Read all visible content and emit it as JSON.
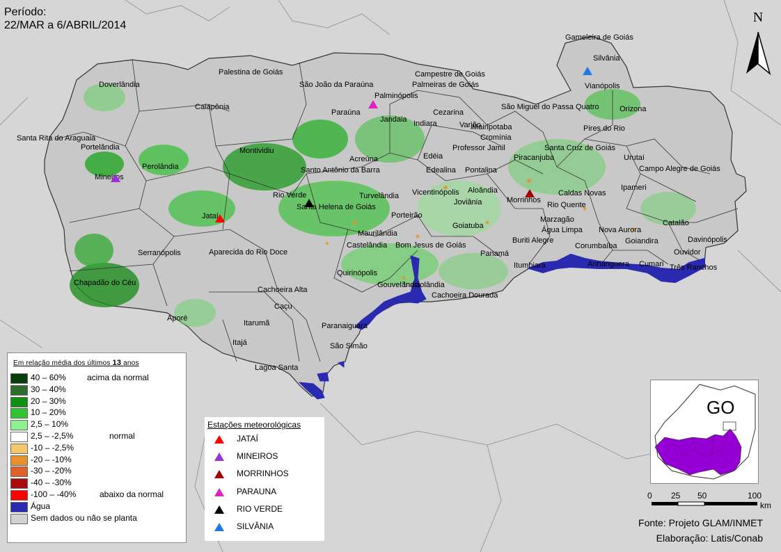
{
  "period": {
    "label": "Período:",
    "range": "22/MAR a 6/ABRIL/2014"
  },
  "north": {
    "letter": "N",
    "icon": "north-arrow-icon"
  },
  "municipality_labels": [
    "Gameleira de Goiás",
    "Silvânia",
    "Vianópolis",
    "Orizona",
    "São Miguel do Passa Quatro",
    "Pires do Rio",
    "Santa Cruz de Goiás",
    "Urutaí",
    "Campo Alegre de Goiás",
    "Ipameri",
    "Caldas Novas",
    "Rio Quente",
    "Marzagão",
    "Nova Aurora",
    "Goiandira",
    "Catalão",
    "Davinópolis",
    "Ouvidor",
    "Três Ranchos",
    "Cumari",
    "Anhanguera",
    "Corumbaíba",
    "Água Limpa",
    "Buriti Alegre",
    "Itumbiara",
    "Morrinhos",
    "Piracanjuba",
    "Cromínia",
    "Mairipotaba",
    "Professor Jamil",
    "Pontalina",
    "Aloândia",
    "Joviânia",
    "Goiatuba",
    "Panamá",
    "Bom Jesus de Goiás",
    "Castelândia",
    "Maurilândia",
    "Porteirão",
    "Turvelândia",
    "Vicentinópolis",
    "Edealina",
    "Edéia",
    "Indiara",
    "Varjão",
    "Cezarina",
    "Jandaia",
    "Palminópolis",
    "Paraúna",
    "Acreúna",
    "Santo Antônio da Barra",
    "Rio Verde",
    "Santa Helena de Goiás",
    "Montividiu",
    "Campestre de Goiás",
    "Palmeiras de Goiás",
    "São João da Paraúna",
    "Palestina de Goiás",
    "Caiapônia",
    "Doverlândia",
    "Santa Rita do Araguaia",
    "Portelândia",
    "Perolândia",
    "Mineiros",
    "Jataí",
    "Serranópolis",
    "Chapadão do Céu",
    "Aporé",
    "Aparecida do Rio Doce",
    "Cachoeira Alta",
    "Caçu",
    "Itarumã",
    "Itajá",
    "Lagoa Santa",
    "Paranaiguara",
    "São Simão",
    "Quirinópolis",
    "Gouvelândia",
    "Inaciolândia",
    "Cachoeira Dourada"
  ],
  "legend": {
    "title_prefix": "Em relação média dos últimos",
    "title_years": "13",
    "title_suffix": "anos",
    "classes": [
      {
        "range": "40 – 60%",
        "note": "acima da normal",
        "color": "#0a3d0a"
      },
      {
        "range": "30 – 40%",
        "note": "",
        "color": "#2f6b2f"
      },
      {
        "range": "20 – 30%",
        "note": "",
        "color": "#0f8f0f"
      },
      {
        "range": "10 – 20%",
        "note": "",
        "color": "#33c233"
      },
      {
        "range": "2,5 – 10%",
        "note": "",
        "color": "#8ef08e"
      },
      {
        "range": "2,5 – -2,5%",
        "note": "normal",
        "color": "#ffffff"
      },
      {
        "range": "-10 – -2,5%",
        "note": "",
        "color": "#f6c66a"
      },
      {
        "range": "-20 – -10%",
        "note": "",
        "color": "#e8922e"
      },
      {
        "range": "-30 – -20%",
        "note": "",
        "color": "#e0602a"
      },
      {
        "range": "-40 – -30%",
        "note": "",
        "color": "#a80c0c"
      },
      {
        "range": "-100 – -40%",
        "note": "abaixo da normal",
        "color": "#ff0000"
      },
      {
        "range": "Água",
        "note": "",
        "color": "#2a2ab0"
      },
      {
        "range": "Sem dados ou não se planta",
        "note": "",
        "color": "#d2d2d2"
      }
    ]
  },
  "stations": {
    "title": "Estações meteorológicas",
    "items": [
      {
        "name": "JATAÍ",
        "color": "#ff0000"
      },
      {
        "name": "MINEIROS",
        "color": "#9b30d9"
      },
      {
        "name": "MORRINHOS",
        "color": "#a00000"
      },
      {
        "name": "PARAUNA",
        "color": "#e020c0"
      },
      {
        "name": "RIO VERDE",
        "color": "#000000"
      },
      {
        "name": "SILVÂNIA",
        "color": "#1e78e6"
      }
    ]
  },
  "inset": {
    "label": "GO",
    "highlight_color": "#9400d3"
  },
  "scale": {
    "ticks": [
      "0",
      "25",
      "50",
      "100"
    ],
    "unit": "km"
  },
  "credits": {
    "source": "Fonte: Projeto GLAM/INMET",
    "author": "Elaboração: Latis/Conab"
  }
}
